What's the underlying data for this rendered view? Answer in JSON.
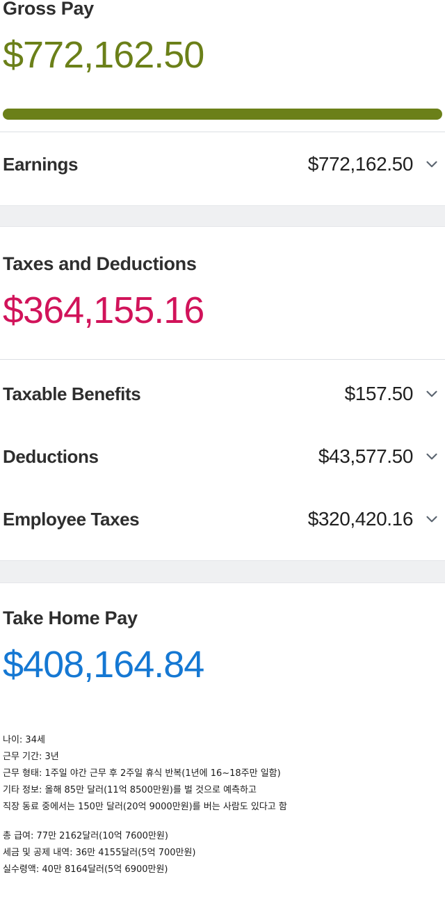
{
  "sections": {
    "gross": {
      "title": "Gross Pay",
      "amount": "$772,162.50",
      "color": "#6b8019",
      "progress_percent": 100,
      "rows": [
        {
          "label": "Earnings",
          "value": "$772,162.50",
          "chevron": "chevron-down-icon"
        }
      ]
    },
    "taxes": {
      "title": "Taxes and Deductions",
      "amount": "$364,155.16",
      "color": "#d1135a",
      "rows": [
        {
          "label": "Taxable Benefits",
          "value": "$157.50",
          "chevron": "chevron-down-icon"
        },
        {
          "label": "Deductions",
          "value": "$43,577.50",
          "chevron": "chevron-down-icon"
        },
        {
          "label": "Employee Taxes",
          "value": "$320,420.16",
          "chevron": "chevron-down-icon"
        }
      ]
    },
    "takehome": {
      "title": "Take Home Pay",
      "amount": "$408,164.84",
      "color": "#1578d3"
    }
  },
  "notes": {
    "group1": [
      "나이: 34세",
      "근무 기간: 3년",
      "근무 형태: 1주일 야간 근무 후 2주일 휴식 반복(1년에 16~18주만 일함)",
      "기타 정보: 올해 85만 달러(11억 8500만원)를 벌 것으로 예측하고",
      "직장 동료 중에서는 150만 달러(20억 9000만원)를 버는 사람도 있다고 함"
    ],
    "group2": [
      "총 급여: 77만 2162달러(10억 7600만원)",
      "세금 및 공제 내역: 36만 4155달러(5억 700만원)",
      "실수령액: 40만 8164달러(5억 6900만원)"
    ]
  }
}
